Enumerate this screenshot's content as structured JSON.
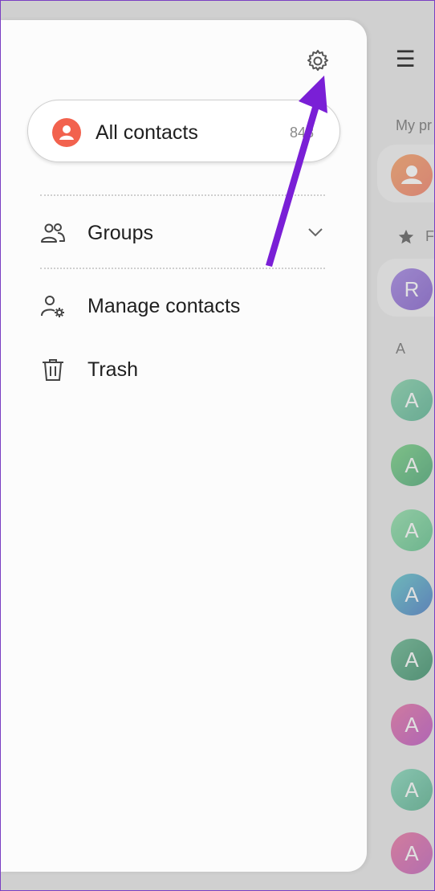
{
  "drawer": {
    "all_contacts": {
      "label": "All contacts",
      "count": "848"
    },
    "items": [
      {
        "label": "Groups"
      },
      {
        "label": "Manage contacts"
      },
      {
        "label": "Trash"
      }
    ]
  },
  "background": {
    "my_profile_label": "My pr",
    "favorites_label": "F",
    "section_letter": "A",
    "favorite_initial": "R",
    "contact_initial": "A"
  },
  "colors": {
    "accent_avatar": "#f2624e",
    "annotation_arrow": "#7a1fd6"
  },
  "icons": [
    "settings-gear-icon",
    "person-icon",
    "groups-icon",
    "chevron-down-icon",
    "manage-contacts-icon",
    "trash-icon",
    "star-icon",
    "hamburger-menu-icon"
  ]
}
